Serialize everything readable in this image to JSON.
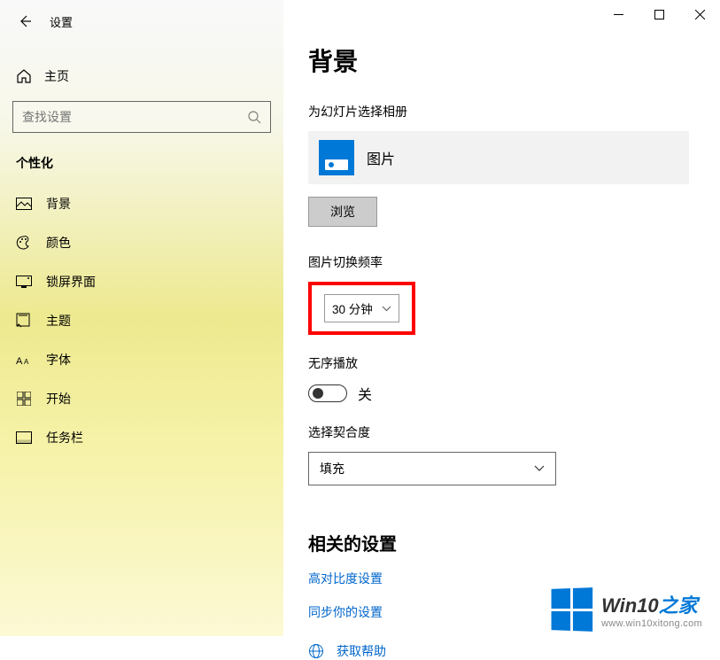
{
  "titlebar": {
    "app_title": "设置"
  },
  "sidebar": {
    "home_label": "主页",
    "search_placeholder": "查找设置",
    "category": "个性化",
    "items": [
      {
        "label": "背景"
      },
      {
        "label": "颜色"
      },
      {
        "label": "锁屏界面"
      },
      {
        "label": "主题"
      },
      {
        "label": "字体"
      },
      {
        "label": "开始"
      },
      {
        "label": "任务栏"
      }
    ]
  },
  "content": {
    "page_title": "背景",
    "album_section_label": "为幻灯片选择相册",
    "album_name": "图片",
    "browse_label": "浏览",
    "frequency_label": "图片切换频率",
    "frequency_value": "30 分钟",
    "shuffle_label": "无序播放",
    "shuffle_state": "关",
    "fit_label": "选择契合度",
    "fit_value": "填充",
    "related_title": "相关的设置",
    "links": [
      "高对比度设置",
      "同步你的设置"
    ],
    "help_label": "获取帮助"
  },
  "watermark": {
    "brand_main": "Win10",
    "brand_suffix": "之家",
    "url": "www.win10xitong.com"
  }
}
